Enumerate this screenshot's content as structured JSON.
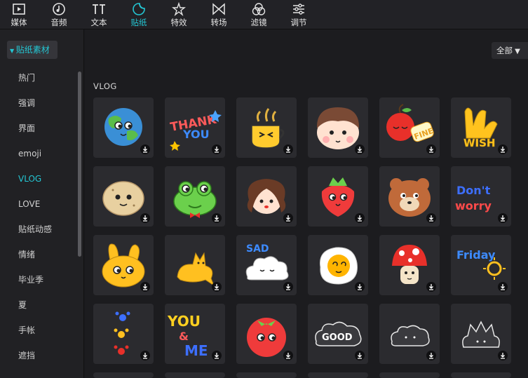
{
  "toolbar": {
    "tabs": [
      {
        "label": "媒体",
        "icon": "media-icon"
      },
      {
        "label": "音频",
        "icon": "audio-icon"
      },
      {
        "label": "文本",
        "icon": "text-icon"
      },
      {
        "label": "贴纸",
        "icon": "sticker-icon",
        "active": true
      },
      {
        "label": "特效",
        "icon": "effects-icon"
      },
      {
        "label": "转场",
        "icon": "transition-icon"
      },
      {
        "label": "滤镜",
        "icon": "filter-icon"
      },
      {
        "label": "调节",
        "icon": "adjust-icon"
      }
    ],
    "accent_color": "#24c6d3"
  },
  "sidebar": {
    "header": "贴纸素材",
    "items": [
      {
        "label": "热门"
      },
      {
        "label": "强调"
      },
      {
        "label": "界面"
      },
      {
        "label": "emoji"
      },
      {
        "label": "VLOG",
        "active": true
      },
      {
        "label": "LOVE"
      },
      {
        "label": "贴纸动感"
      },
      {
        "label": "情绪"
      },
      {
        "label": "毕业季"
      },
      {
        "label": "夏"
      },
      {
        "label": "手帐"
      },
      {
        "label": "遮挡"
      }
    ]
  },
  "main": {
    "filter_label": "全部",
    "section_title": "VLOG",
    "stickers": [
      {
        "name": "earth",
        "text": ""
      },
      {
        "name": "thank-you",
        "text": "THANK YOU"
      },
      {
        "name": "coffee-cup",
        "text": ""
      },
      {
        "name": "boy-face",
        "text": ""
      },
      {
        "name": "apple-fine",
        "text": "FINE"
      },
      {
        "name": "hands-wish",
        "text": "WISH"
      },
      {
        "name": "potato",
        "text": ""
      },
      {
        "name": "frog",
        "text": ""
      },
      {
        "name": "girl-face",
        "text": ""
      },
      {
        "name": "strawberry",
        "text": ""
      },
      {
        "name": "bear",
        "text": ""
      },
      {
        "name": "dont-worry",
        "text": "Don't worry"
      },
      {
        "name": "rabbit",
        "text": ""
      },
      {
        "name": "cat",
        "text": ""
      },
      {
        "name": "sad-cloud",
        "text": "SAD"
      },
      {
        "name": "fried-egg",
        "text": ""
      },
      {
        "name": "mushroom",
        "text": ""
      },
      {
        "name": "friday",
        "text": "Friday"
      },
      {
        "name": "paw-prints",
        "text": ""
      },
      {
        "name": "you-and-me",
        "text": "YOU & ME"
      },
      {
        "name": "tomato",
        "text": ""
      },
      {
        "name": "good-cloud",
        "text": "GOOD"
      },
      {
        "name": "white-cloud",
        "text": ""
      },
      {
        "name": "white-crown",
        "text": ""
      }
    ]
  }
}
